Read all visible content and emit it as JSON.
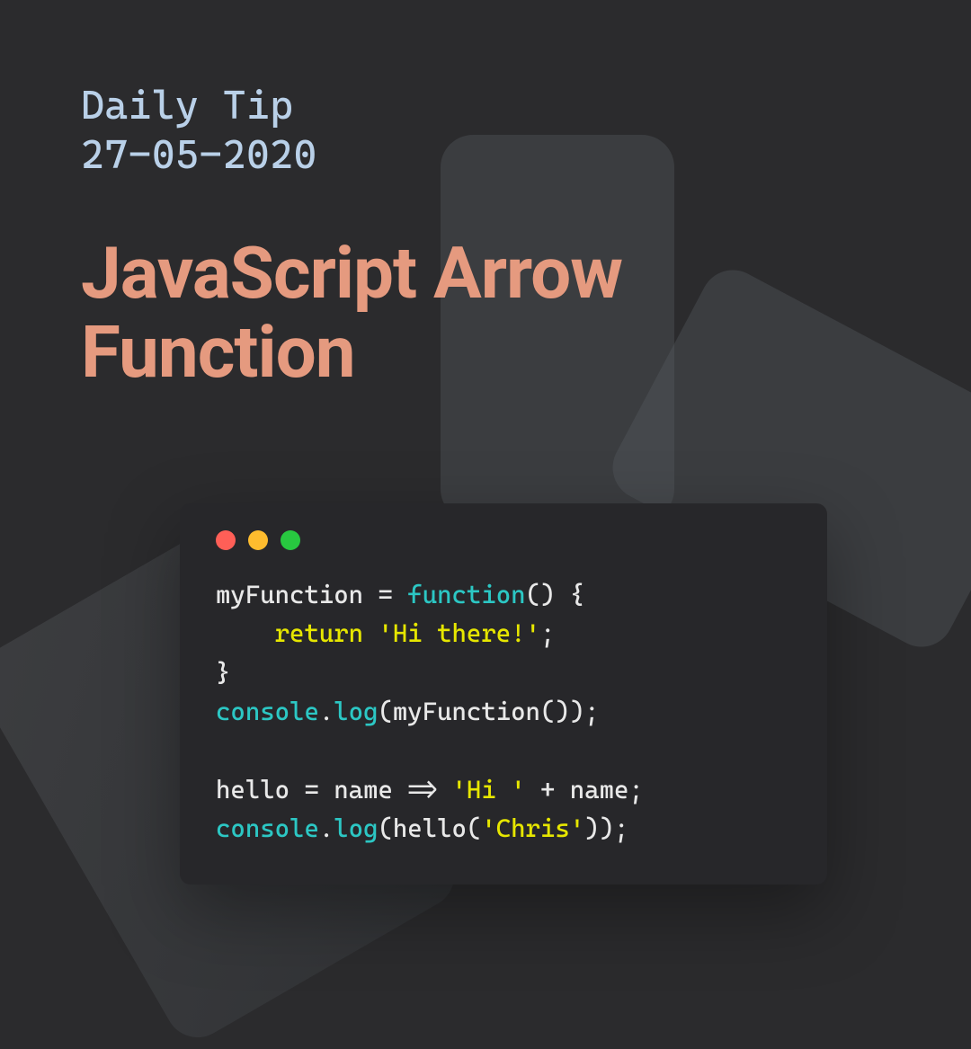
{
  "header": {
    "series": "Daily Tip",
    "date": "27-05-2020",
    "title": "JavaScript Arrow Function"
  },
  "window": {
    "dot_colors": {
      "red": "#ff5f57",
      "yellow": "#febc2e",
      "green": "#28c840"
    }
  },
  "code": {
    "tokens": [
      [
        {
          "t": "myFunction ",
          "c": "id"
        },
        {
          "t": "=",
          "c": "op"
        },
        {
          "t": " ",
          "c": "id"
        },
        {
          "t": "function",
          "c": "kw"
        },
        {
          "t": "() {",
          "c": "punc"
        }
      ],
      [
        {
          "t": "    ",
          "c": "id"
        },
        {
          "t": "return",
          "c": "ret"
        },
        {
          "t": " ",
          "c": "id"
        },
        {
          "t": "'Hi there!'",
          "c": "str"
        },
        {
          "t": ";",
          "c": "punc"
        }
      ],
      [
        {
          "t": "}",
          "c": "punc"
        }
      ],
      [
        {
          "t": "console",
          "c": "call"
        },
        {
          "t": ".",
          "c": "punc"
        },
        {
          "t": "log",
          "c": "call"
        },
        {
          "t": "(",
          "c": "punc"
        },
        {
          "t": "myFunction",
          "c": "id"
        },
        {
          "t": "());",
          "c": "punc"
        }
      ],
      [
        {
          "t": "",
          "c": "id"
        }
      ],
      [
        {
          "t": "hello ",
          "c": "id"
        },
        {
          "t": "=",
          "c": "op"
        },
        {
          "t": " name ",
          "c": "id"
        },
        {
          "t": "=>",
          "c": "op"
        },
        {
          "t": " ",
          "c": "id"
        },
        {
          "t": "'Hi '",
          "c": "str"
        },
        {
          "t": " ",
          "c": "id"
        },
        {
          "t": "+",
          "c": "op"
        },
        {
          "t": " name;",
          "c": "id"
        }
      ],
      [
        {
          "t": "console",
          "c": "call"
        },
        {
          "t": ".",
          "c": "punc"
        },
        {
          "t": "log",
          "c": "call"
        },
        {
          "t": "(",
          "c": "punc"
        },
        {
          "t": "hello",
          "c": "id"
        },
        {
          "t": "(",
          "c": "punc"
        },
        {
          "t": "'Chris'",
          "c": "str"
        },
        {
          "t": "));",
          "c": "punc"
        }
      ]
    ]
  }
}
